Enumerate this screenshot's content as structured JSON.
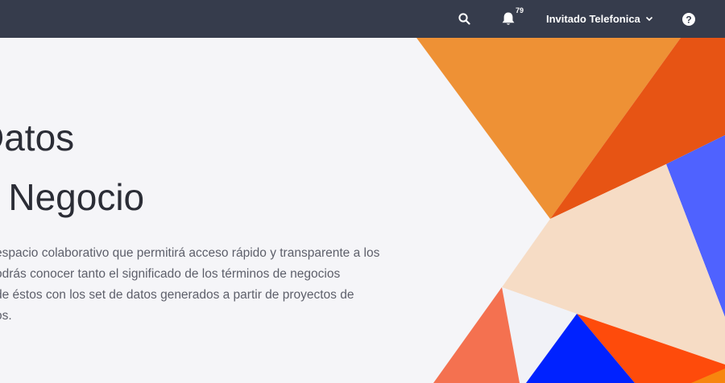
{
  "topbar": {
    "notifications_count": "79",
    "user_name": "Invitado Telefonica",
    "icons": {
      "search": "search-icon",
      "bell": "bell-icon",
      "chevron": "chevron-down-icon",
      "help": "help-icon"
    }
  },
  "hero": {
    "title_line1": "Datos",
    "title_line2": "e Negocio",
    "description_lines": [
      "espacio colaborativo que permitirá acceso rápido y transparente a los",
      "odrás conocer tanto el significado de los términos de negocios",
      "de éstos con los set de datos generados a partir de proyectos de",
      "os."
    ]
  },
  "colors": {
    "topbar_bg": "#363c4c",
    "page_bg": "#f5f5f8",
    "orange": "#ee9135",
    "dark_orange": "#e75414",
    "peach": "#f6dcc5",
    "blue": "#4f62ff",
    "deep_blue": "#0022ff",
    "coral": "#f47150"
  }
}
